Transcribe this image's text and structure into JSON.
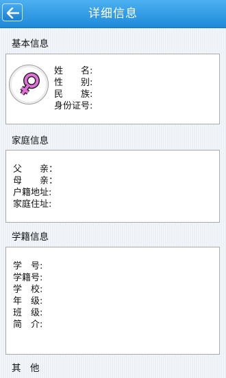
{
  "header": {
    "title": "详细信息"
  },
  "basic": {
    "title": "基本信息",
    "fields": [
      {
        "label": "姓　　名",
        "colon": ":"
      },
      {
        "label": "性　　别",
        "colon": ":"
      },
      {
        "label": "民　　族",
        "colon": ":"
      },
      {
        "label": "身份证号",
        "colon": ":"
      }
    ]
  },
  "family": {
    "title": "家庭信息",
    "fields": [
      {
        "label": "父　　亲",
        "colon": "："
      },
      {
        "label": "母　　亲",
        "colon": "："
      },
      {
        "label": "户籍地址",
        "colon": ":"
      },
      {
        "label": "家庭住址",
        "colon": ":"
      }
    ]
  },
  "school": {
    "title": "学籍信息",
    "fields": [
      {
        "label": "学　号",
        "colon": ":"
      },
      {
        "label": "学籍号",
        "colon": ":"
      },
      {
        "label": "学　校",
        "colon": ":"
      },
      {
        "label": "年　级",
        "colon": ":"
      },
      {
        "label": "班　级",
        "colon": ":"
      },
      {
        "label": "简　介",
        "colon": ":"
      }
    ]
  },
  "other": {
    "title": "其　他"
  },
  "colors": {
    "header": "#2a98e2",
    "female_symbol": "#e070d8",
    "female_symbol_outline": "#222222"
  },
  "icons": {
    "back": "back-arrow-icon",
    "gender": "female-symbol-icon"
  }
}
